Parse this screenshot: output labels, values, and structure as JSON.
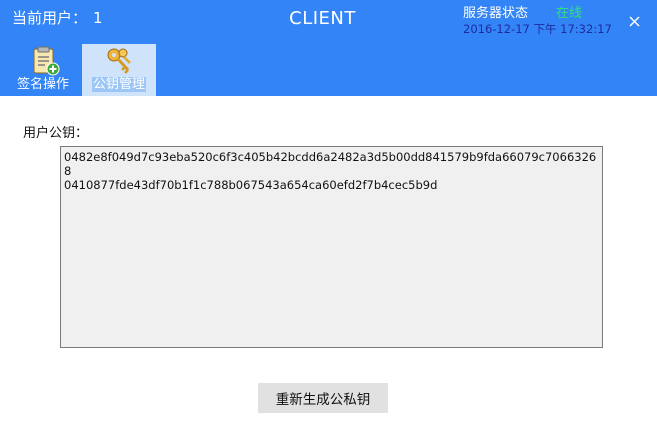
{
  "header": {
    "current_user_label": "当前用户：",
    "current_user_count": "1",
    "title": "CLIENT",
    "server_status_label": "服务器状态",
    "server_status_value": "在线",
    "datetime": "2016-12-17 下午 17:32:17"
  },
  "tabs": [
    {
      "label": "签名操作",
      "icon": "clipboard-add-icon"
    },
    {
      "label": "公钥管理",
      "icon": "keys-icon",
      "selected": true
    }
  ],
  "main": {
    "pubkey_label": "用户公钥：",
    "pubkey_line1": "0482e8f049d7c93eba520c6f3c405b42bcdd6a2482a3d5b00dd841579b9fda66079c70663268",
    "pubkey_line2": "0410877fde43df70b1f1c788b067543a654ca60efd2f7b4cec5b9d",
    "regen_button": "重新生成公私钥"
  },
  "colors": {
    "header_bg": "#3385f7",
    "status_online": "#2ee27a",
    "datetime_text": "#1f2aa0"
  }
}
